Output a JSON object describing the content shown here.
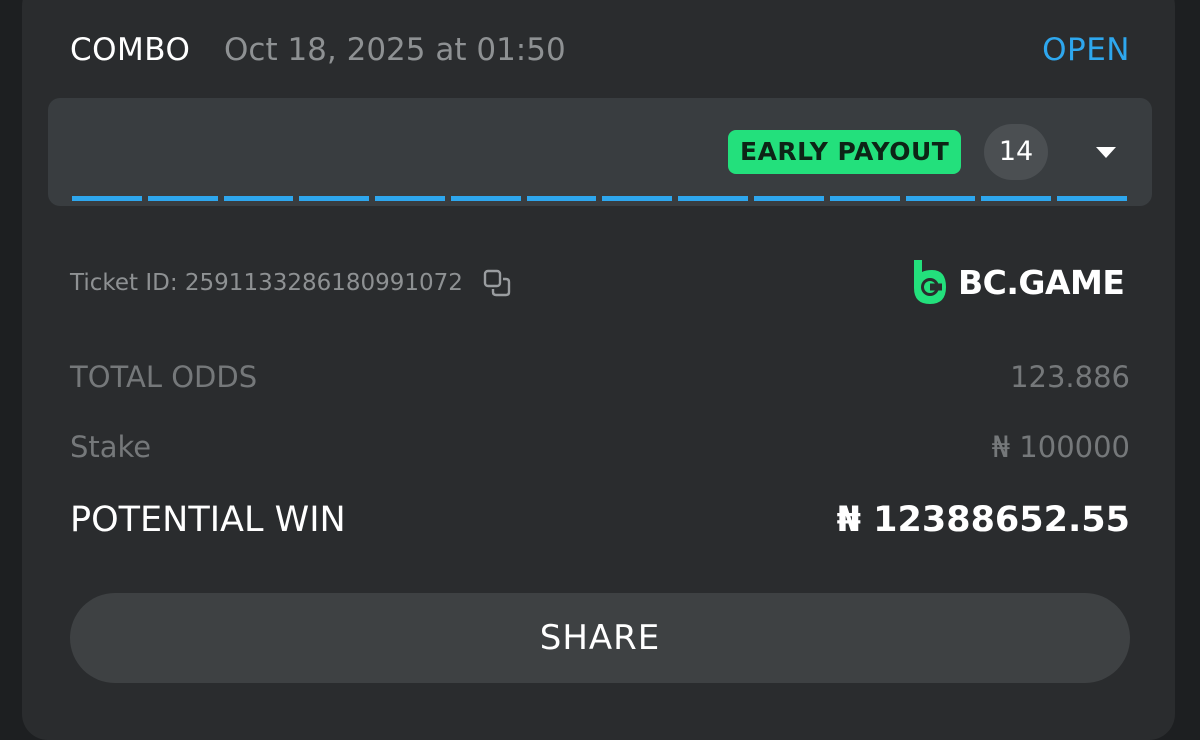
{
  "bet": {
    "type": "COMBO",
    "date": "Oct 18, 2025 at 01:50",
    "status": "OPEN"
  },
  "legs": {
    "badge": "EARLY PAYOUT",
    "count": "14",
    "toggle_icon": "caret-down-icon"
  },
  "ticket": {
    "label": "Ticket ID: 2591133286180991072",
    "copy_icon": "copy-icon"
  },
  "brand": {
    "name": "BC.GAME",
    "logo_icon": "bc-game-logo"
  },
  "summary": {
    "total_odds_label": "TOTAL ODDS",
    "total_odds_value": "123.886",
    "stake_label": "Stake",
    "stake_value": "₦ 100000",
    "potential_win_label": "POTENTIAL WIN",
    "potential_win_value": "₦ 12388652.55"
  },
  "share_label": "SHARE",
  "colors": {
    "accent": "#2ea7ee",
    "badge": "#23e07c",
    "background": "#2a2c2e",
    "panel": "#393d40"
  }
}
